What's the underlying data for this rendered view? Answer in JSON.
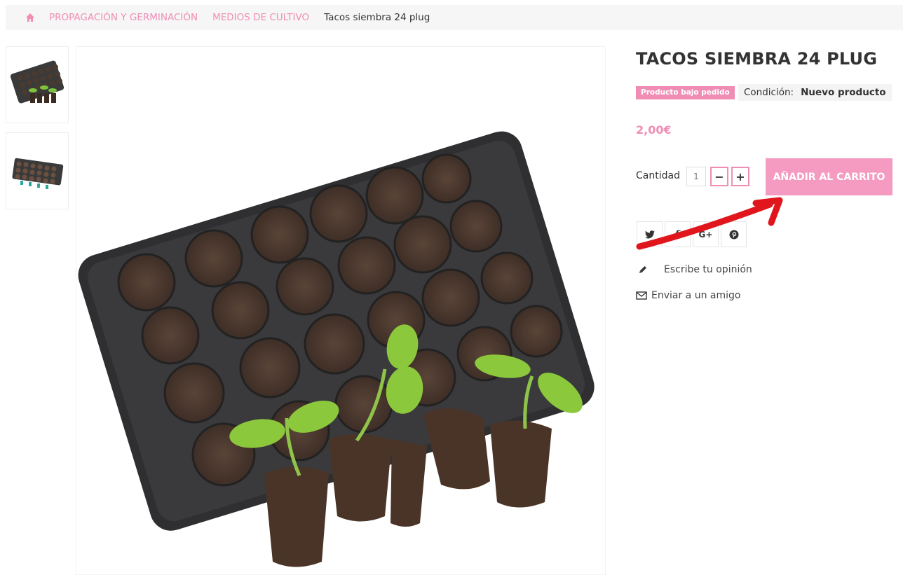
{
  "breadcrumb": {
    "items": [
      "PROPAGACIÓN Y GERMINACIÓN",
      "MEDIOS DE CULTIVO"
    ],
    "current": "Tacos siembra 24 plug"
  },
  "product": {
    "title": "TACOS SIEMBRA 24 PLUG",
    "availability_badge": "Producto bajo pedido",
    "condition_label": "Condición:",
    "condition_value": "Nuevo producto",
    "price": "2,00€",
    "quantity_label": "Cantidad",
    "quantity_value": "1",
    "minus_label": "−",
    "plus_label": "+",
    "add_to_cart_label": "AÑADIR AL CARRITO"
  },
  "social": {
    "icons": [
      "twitter-icon",
      "facebook-icon",
      "google-plus-icon",
      "pinterest-icon"
    ],
    "facebook_glyph": "f",
    "google_glyph": "G+"
  },
  "links": {
    "write_review": "Escribe tu opinión",
    "send_to_friend": "Enviar a un amigo"
  },
  "colors": {
    "accent": "#f08db4",
    "button": "#f59ac0",
    "annotation_arrow": "#e0161c"
  }
}
